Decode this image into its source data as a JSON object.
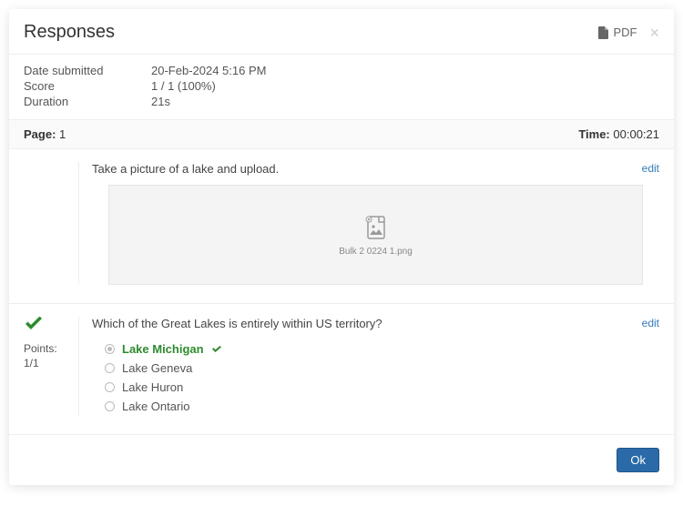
{
  "header": {
    "title": "Responses",
    "pdf_label": "PDF"
  },
  "meta": {
    "date_label": "Date submitted",
    "date_value": "20-Feb-2024 5:16 PM",
    "score_label": "Score",
    "score_value": "1 / 1 (100%)",
    "duration_label": "Duration",
    "duration_value": "21s"
  },
  "pagebar": {
    "page_label": "Page:",
    "page_num": "1",
    "time_label": "Time:",
    "time_value": "00:00:21"
  },
  "q1": {
    "text": "Take a picture of a lake and upload.",
    "edit": "edit",
    "filename": "Bulk 2 0224 1.png"
  },
  "q2": {
    "text": "Which of the Great Lakes is entirely within US territory?",
    "edit": "edit",
    "points_label": "Points:",
    "points_value": "1/1",
    "options": {
      "0": "Lake Michigan",
      "1": "Lake Geneva",
      "2": "Lake Huron",
      "3": "Lake Ontario"
    }
  },
  "footer": {
    "ok": "Ok"
  }
}
